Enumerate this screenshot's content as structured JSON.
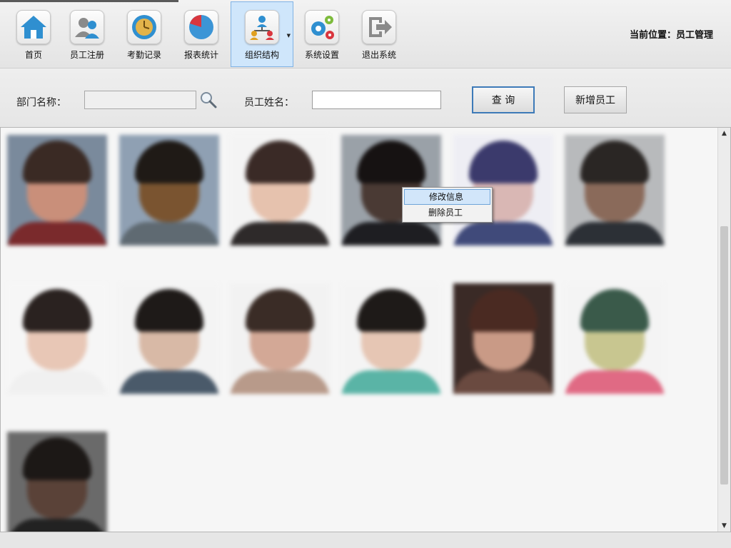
{
  "toolbar": {
    "items": [
      {
        "label": "首页",
        "icon": "home-icon"
      },
      {
        "label": "员工注册",
        "icon": "users-icon"
      },
      {
        "label": "考勤记录",
        "icon": "clock-icon"
      },
      {
        "label": "报表统计",
        "icon": "pie-chart-icon"
      },
      {
        "label": "组织结构",
        "icon": "org-chart-icon",
        "active": true
      },
      {
        "label": "系统设置",
        "icon": "gears-icon"
      },
      {
        "label": "退出系统",
        "icon": "exit-icon"
      }
    ],
    "location_label": "当前位置：员工管理"
  },
  "search": {
    "dept_label": "部门名称：",
    "dept_value": "",
    "name_label": "员工姓名：",
    "name_value": "",
    "query_label": "查 询",
    "add_label": "新增员工"
  },
  "context_menu": {
    "items": [
      "修改信息",
      "删除员工"
    ]
  },
  "colors": {
    "accent": "#3d7ab8",
    "active_tab_bg": "#cfe6fb",
    "menu_highlight": "#d2e6fa"
  }
}
